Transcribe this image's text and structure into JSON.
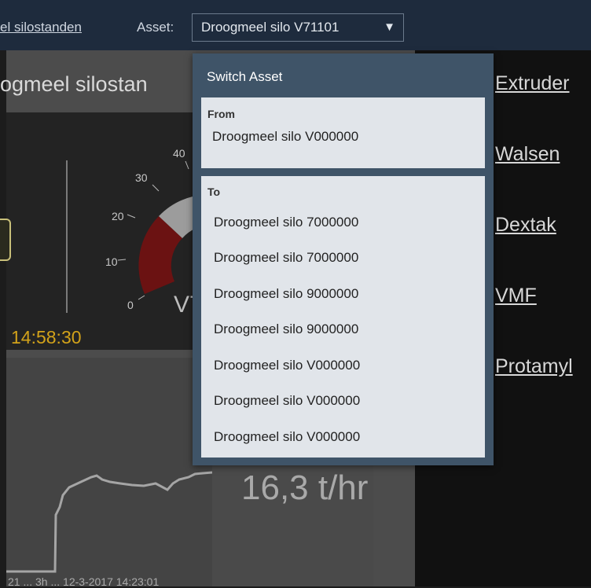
{
  "header": {
    "breadcrumb": "el silostanden",
    "asset_label": "Asset:",
    "asset_selected": "Droogmeel silo V71101",
    "caret": "▼"
  },
  "main": {
    "panel_title": "ogmeel silostan",
    "time": "14:58:30",
    "gauge_ticks": [
      "0",
      "10",
      "20",
      "30",
      "40"
    ],
    "gauge_label": "V7",
    "flow_value": "16,3 t/hr",
    "axis_text": "21 ... 3h ... 12-3-2017 14:23:01"
  },
  "right_links": [
    "Extruder",
    "Walsen",
    "Dextak",
    "VMF",
    "Protamyl"
  ],
  "popup": {
    "title": "Switch Asset",
    "from_heading": "From",
    "from_value": "Droogmeel silo V000000",
    "to_heading": "To",
    "to_items": [
      "Droogmeel silo 7000000",
      "Droogmeel silo 7000000",
      "Droogmeel silo 9000000",
      "Droogmeel silo 9000000",
      "Droogmeel silo V000000",
      "Droogmeel silo V000000",
      "Droogmeel silo V000000"
    ]
  },
  "colors": {
    "topbar": "#1e2b3d",
    "popup": "#3f5468",
    "gauge_red": "#6b1212",
    "time_yellow": "#d2a21a"
  }
}
